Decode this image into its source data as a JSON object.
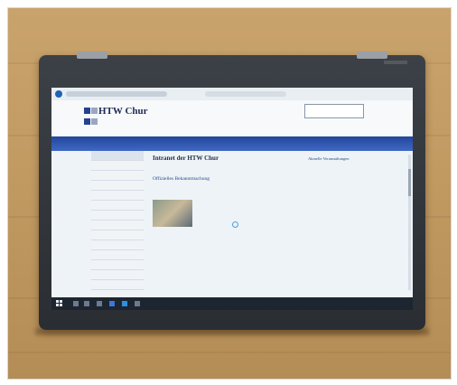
{
  "site": {
    "brand": "HTW Chur",
    "page_title": "Intranet der HTW Chur",
    "post_title": "Offizielles Bekanntmachung",
    "right_col_heading": "Aktuelle Veranstaltungen"
  },
  "colors": {
    "surface": "#c19a62",
    "bezel": "#2f3439",
    "banner": "#2a4ea8",
    "taskbar": "#1d2530"
  }
}
